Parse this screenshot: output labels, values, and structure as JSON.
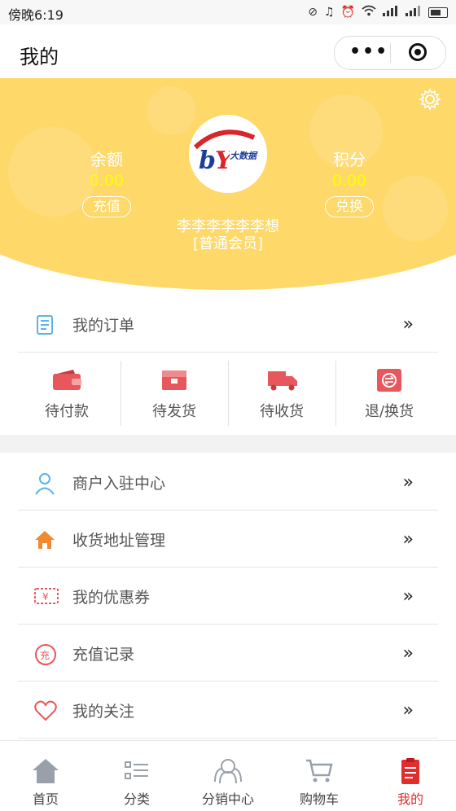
{
  "status_bar": {
    "time": "傍晚6:19"
  },
  "nav": {
    "title": "我的"
  },
  "header": {
    "balance_label": "余额",
    "balance_value": "0.00",
    "recharge_button": "充值",
    "points_label": "积分",
    "points_value": "0.00",
    "exchange_button": "兑换",
    "logo_text": "大数据",
    "username": "李李李李李李想",
    "member_level": "[普通会员]"
  },
  "orders": {
    "label": "我的订单",
    "statuses": [
      {
        "label": "待付款",
        "icon": "wallet-icon"
      },
      {
        "label": "待发货",
        "icon": "package-icon"
      },
      {
        "label": "待收货",
        "icon": "truck-icon"
      },
      {
        "label": "退/换货",
        "icon": "return-icon"
      }
    ]
  },
  "menu": [
    {
      "label": "商户入驻中心",
      "icon": "merchant-icon"
    },
    {
      "label": "收货地址管理",
      "icon": "home-icon"
    },
    {
      "label": "我的优惠券",
      "icon": "coupon-icon"
    },
    {
      "label": "充值记录",
      "icon": "recharge-record-icon"
    },
    {
      "label": "我的关注",
      "icon": "heart-icon"
    }
  ],
  "arrow_glyph": "»",
  "tabs": [
    {
      "label": "首页",
      "icon": "home-tab-icon"
    },
    {
      "label": "分类",
      "icon": "category-icon"
    },
    {
      "label": "分销中心",
      "icon": "distribution-icon"
    },
    {
      "label": "购物车",
      "icon": "cart-icon"
    },
    {
      "label": "我的",
      "icon": "profile-icon",
      "active": true
    }
  ],
  "colors": {
    "header": "#fed869",
    "accent": "#e02e2e",
    "value": "#ffff00"
  }
}
